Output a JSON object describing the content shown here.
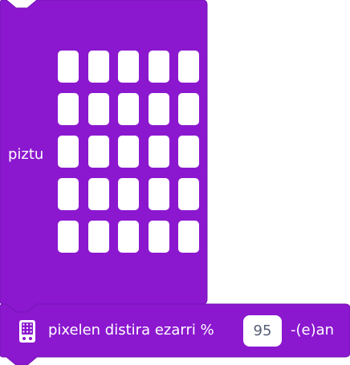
{
  "colors": {
    "block_fill": "#8b18cf",
    "block_stroke": "#6e0fa8",
    "pixel_on": "#ffffff",
    "input_text": "#575e75"
  },
  "block_matrix": {
    "label": "piztu",
    "grid_rows": 5,
    "grid_cols": 5,
    "pixels": [
      [
        1,
        1,
        1,
        1,
        1
      ],
      [
        1,
        1,
        1,
        1,
        1
      ],
      [
        1,
        1,
        1,
        1,
        1
      ],
      [
        1,
        1,
        1,
        1,
        1
      ],
      [
        1,
        1,
        1,
        1,
        1
      ]
    ]
  },
  "block_brightness": {
    "icon": "microbit-device-icon",
    "label": "pixelen distira ezarri %",
    "value": "95",
    "suffix": "-(e)an"
  }
}
